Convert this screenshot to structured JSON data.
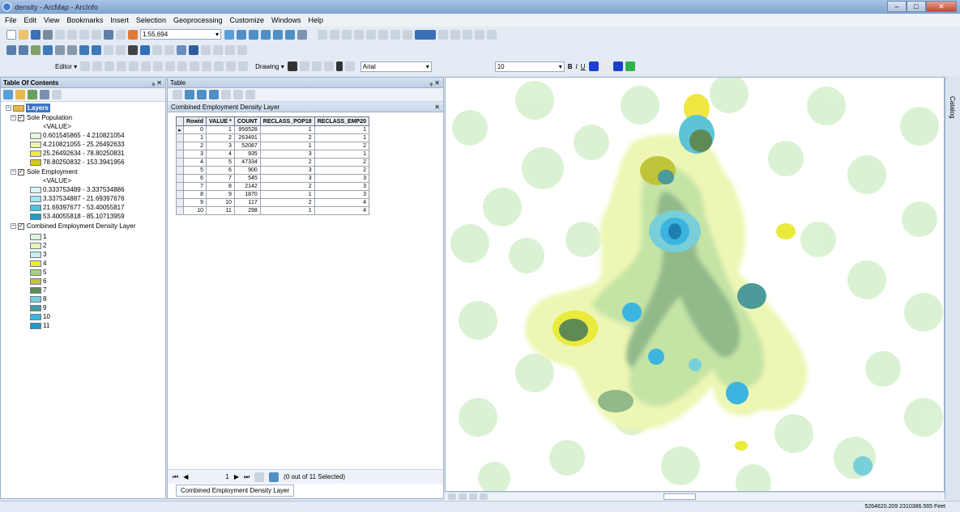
{
  "window": {
    "title": "density - ArcMap - ArcInfo",
    "min": "–",
    "max": "□",
    "close": "✕"
  },
  "menu": [
    "File",
    "Edit",
    "View",
    "Bookmarks",
    "Insert",
    "Selection",
    "Geoprocessing",
    "Customize",
    "Windows",
    "Help"
  ],
  "toolbar": {
    "scale": "1:55,694",
    "editor": "Editor ▾",
    "drawing": "Drawing ▾",
    "font": "Arial",
    "font_size": "10",
    "bold": "B",
    "italic": "I",
    "underline": "U"
  },
  "toc": {
    "title": "Table Of Contents",
    "root": "Layers",
    "groups": [
      {
        "name": "Sole Population",
        "value_label": "<VALUE>",
        "classes": [
          {
            "label": "0.601545865 - 4.210821054",
            "color": "#e8f7d8"
          },
          {
            "label": "4.210821055 - 25.26492633",
            "color": "#e9f4a8"
          },
          {
            "label": "25.26492634 - 78.80250831",
            "color": "#f2ec3a"
          },
          {
            "label": "78.80250832 - 153.3941956",
            "color": "#d9c61a"
          }
        ]
      },
      {
        "name": "Sole Employment",
        "value_label": "<VALUE>",
        "classes": [
          {
            "label": "0.333753489 - 3.337534886",
            "color": "#dff3f3"
          },
          {
            "label": "3.337534887 - 21.69397676",
            "color": "#a6e4ea"
          },
          {
            "label": "21.69397677 - 53.40055817",
            "color": "#4fc3dd"
          },
          {
            "label": "53.40055818 - 85.10713959",
            "color": "#1aa0c8"
          }
        ]
      },
      {
        "name": "Combined Employment Density Layer",
        "value_label": "",
        "classes": [
          {
            "label": "1",
            "color": "#dff5dc"
          },
          {
            "label": "2",
            "color": "#e6f4b4"
          },
          {
            "label": "3",
            "color": "#c8ecec"
          },
          {
            "label": "4",
            "color": "#eaea3c"
          },
          {
            "label": "5",
            "color": "#a9cf8a"
          },
          {
            "label": "6",
            "color": "#c6c42c"
          },
          {
            "label": "7",
            "color": "#5f8a54"
          },
          {
            "label": "8",
            "color": "#79cfd9"
          },
          {
            "label": "9",
            "color": "#4c9a9a"
          },
          {
            "label": "10",
            "color": "#3cb4e0"
          },
          {
            "label": "11",
            "color": "#1d9cc9"
          }
        ]
      }
    ]
  },
  "table": {
    "title": "Table",
    "layer_title": "Combined Employment Density Layer",
    "columns": [
      "Rowid",
      "VALUE *",
      "COUNT",
      "RECLASS_POP18",
      "RECLASS_EMP20"
    ],
    "rows": [
      [
        "0",
        "1",
        "956528",
        "1",
        "1"
      ],
      [
        "1",
        "2",
        "263491",
        "2",
        "1"
      ],
      [
        "2",
        "3",
        "52087",
        "1",
        "2"
      ],
      [
        "3",
        "4",
        "935",
        "3",
        "1"
      ],
      [
        "4",
        "5",
        "47334",
        "2",
        "2"
      ],
      [
        "5",
        "6",
        "900",
        "3",
        "2"
      ],
      [
        "6",
        "7",
        "545",
        "3",
        "3"
      ],
      [
        "7",
        "8",
        "2142",
        "2",
        "3"
      ],
      [
        "8",
        "9",
        "1870",
        "1",
        "3"
      ],
      [
        "9",
        "10",
        "117",
        "2",
        "4"
      ],
      [
        "10",
        "11",
        "298",
        "1",
        "4"
      ]
    ],
    "record_nav": "1",
    "selection_status": "(0 out of 11 Selected)",
    "tab_label": "Combined Employment Density Layer"
  },
  "catalog_label": "Catalog",
  "status": {
    "coords": "5264620.209  2310386.565 Feet"
  }
}
